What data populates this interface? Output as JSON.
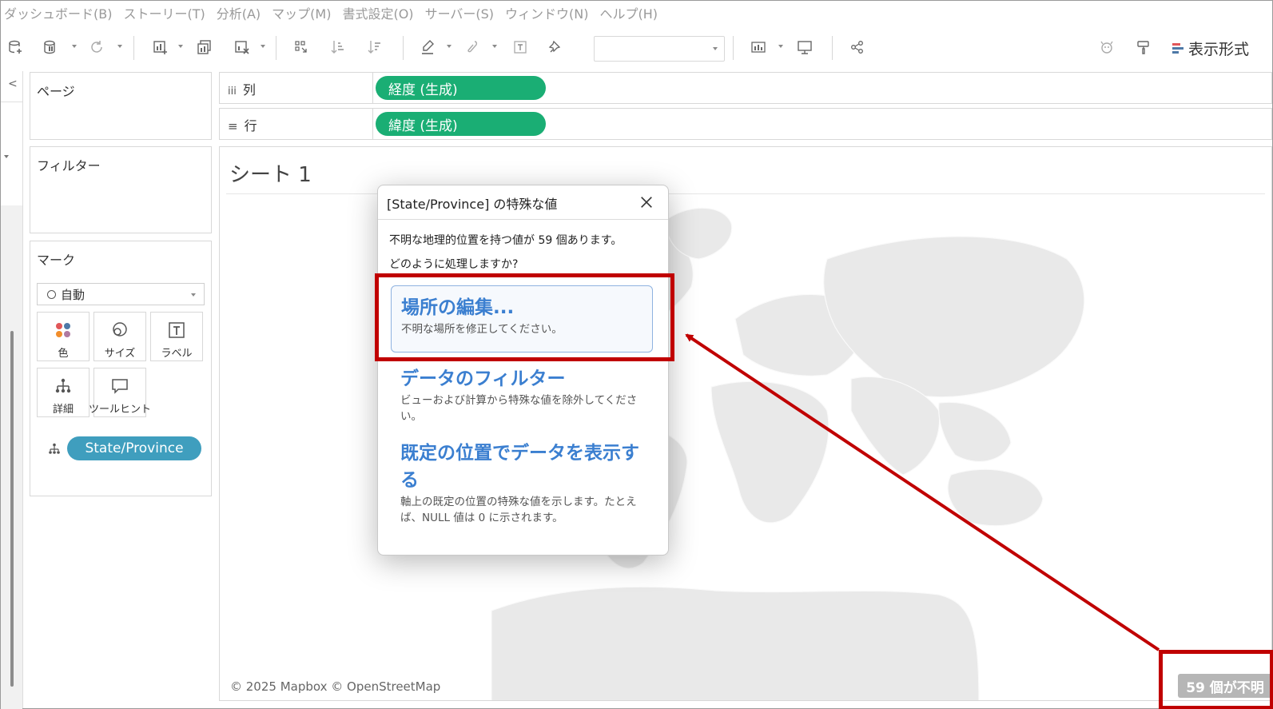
{
  "menu": [
    "ダッシュボード(B)",
    "ストーリー(T)",
    "分析(A)",
    "マップ(M)",
    "書式設定(O)",
    "サーバー(S)",
    "ウィンドウ(N)",
    "ヘルプ(H)"
  ],
  "toolbar": {
    "show_me_label": "表示形式",
    "icons": [
      "new-data-source-icon",
      "pause-updates-icon",
      "refresh-icon",
      "new-worksheet-icon",
      "duplicate-sheet-icon",
      "clear-sheet-icon",
      "swap-icon",
      "sort-ascending-icon",
      "sort-descending-icon",
      "highlight-icon",
      "group-icon",
      "label-icon",
      "pin-icon",
      "fit-icon",
      "presentation-icon",
      "share-icon",
      "datasource-icon",
      "paint-icon"
    ],
    "colors": {
      "show_me_bars": [
        "#e15759",
        "#4e79a7",
        "#4e79a7"
      ]
    }
  },
  "left": {
    "pages_title": "ページ",
    "filters_title": "フィルター",
    "marks": {
      "title": "マーク",
      "mark_type": "自動",
      "buttons": [
        "色",
        "サイズ",
        "ラベル",
        "詳細",
        "ツールヒント"
      ],
      "field_pill": "State/Province",
      "field_pill_color": "#3f9ebe"
    }
  },
  "shelves": {
    "columns_label": "列",
    "rows_label": "行",
    "columns_pill": "経度 (生成)",
    "rows_pill": "緯度 (生成)",
    "pill_color": "#1aae74"
  },
  "view": {
    "sheet_title": "シート 1",
    "attribution": "© 2025 Mapbox © OpenStreetMap",
    "unknown_badge": "59 個が不明"
  },
  "dialog": {
    "title": "[State/Province] の特殊な値",
    "message_line1": "不明な地理的位置を持つ値が 59 個あります。",
    "message_line2": "どのように処理しますか?",
    "options": [
      {
        "title": "場所の編集...",
        "desc": "不明な場所を修正してください。"
      },
      {
        "title": "データのフィルター",
        "desc": "ビューおよび計算から特殊な値を除外してください。"
      },
      {
        "title": "既定の位置でデータを表示する",
        "desc": "軸上の既定の位置の特殊な値を示します。たとえば、NULL 値は 0 に示されます。"
      }
    ],
    "link_color": "#3b7fd0"
  },
  "annotation": {
    "color": "#c00000"
  }
}
